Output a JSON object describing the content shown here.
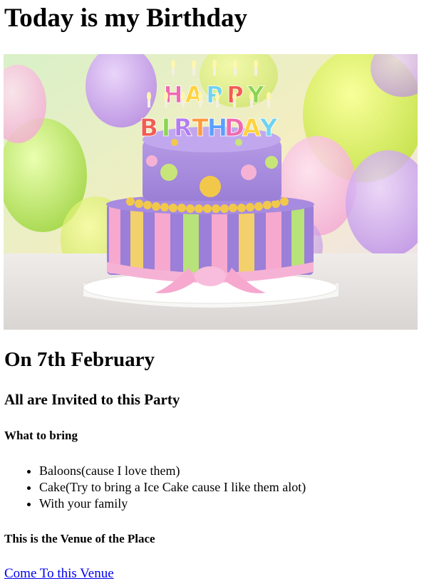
{
  "page": {
    "title": "Today is my Birthday",
    "date_heading": "On 7th February",
    "invite_heading": "All are Invited to this Party",
    "bring_heading": "What to bring",
    "bring_items": [
      "Baloons(cause I love them)",
      "Cake(Try to bring a Ice Cake cause I like them alot)",
      "With your family"
    ],
    "venue_heading": "This is the Venue of the Place",
    "venue_link": "Come To this Venue"
  },
  "image": {
    "topper_line1": [
      "H",
      "A",
      "P",
      "P",
      "Y"
    ],
    "topper_line2": [
      "B",
      "I",
      "R",
      "T",
      "H",
      "D",
      "A",
      "Y"
    ],
    "topper_colors": [
      "#f06ab0",
      "#ffd23f",
      "#6ed3f0",
      "#f25c54",
      "#8bd450",
      "#b47cf0",
      "#ff9b3d",
      "#5aa0ff"
    ]
  }
}
